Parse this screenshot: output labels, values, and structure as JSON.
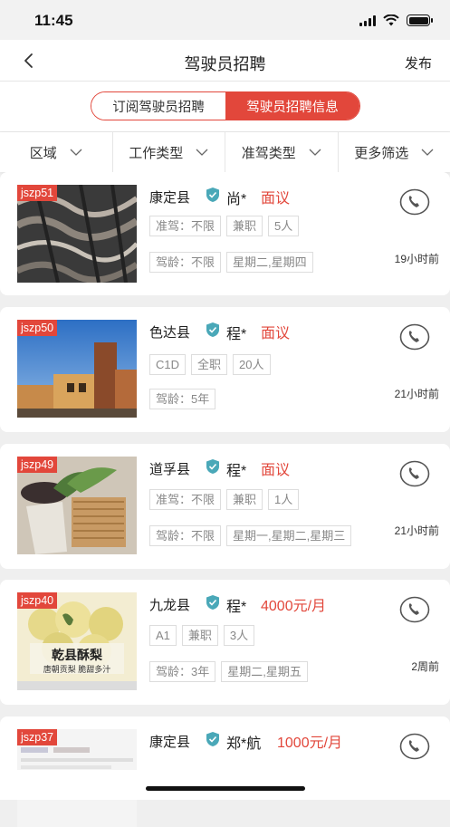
{
  "status": {
    "time": "11:45"
  },
  "navbar": {
    "title": "驾驶员招聘",
    "publish": "发布"
  },
  "segments": {
    "left": "订阅驾驶员招聘",
    "right": "驾驶员招聘信息"
  },
  "filters": [
    "区域",
    "工作类型",
    "准驾类型",
    "更多筛选"
  ],
  "colors": {
    "accent": "#e2473b",
    "verified": "#4aa8b8"
  },
  "listings": [
    {
      "id": "jszp51",
      "location": "康定县",
      "name": "尚*",
      "salary": "面议",
      "row1": [
        "准驾：不限",
        "兼职",
        "5人"
      ],
      "row2": [
        "驾龄：不限",
        "星期二,星期四"
      ],
      "time": "19小时前"
    },
    {
      "id": "jszp50",
      "location": "色达县",
      "name": "程*",
      "salary": "面议",
      "row1": [
        "C1D",
        "全职",
        "20人"
      ],
      "row2": [
        "驾龄：5年"
      ],
      "time": "21小时前"
    },
    {
      "id": "jszp49",
      "location": "道孚县",
      "name": "程*",
      "salary": "面议",
      "row1": [
        "准驾：不限",
        "兼职",
        "1人"
      ],
      "row2": [
        "驾龄：不限",
        "星期一,星期二,星期三"
      ],
      "time": "21小时前"
    },
    {
      "id": "jszp40",
      "location": "九龙县",
      "name": "程*",
      "salary": "4000元/月",
      "row1": [
        "A1",
        "兼职",
        "3人"
      ],
      "row2": [
        "驾龄：3年",
        "星期二,星期五"
      ],
      "time": "2周前",
      "image_text": {
        "title": "乾县酥梨",
        "subtitle": "唐朝贡梨 脆甜多汁"
      }
    },
    {
      "id": "jszp37",
      "location": "康定县",
      "name": "郑*航",
      "salary": "1000元/月",
      "row1": [],
      "row2": [],
      "time": ""
    }
  ]
}
